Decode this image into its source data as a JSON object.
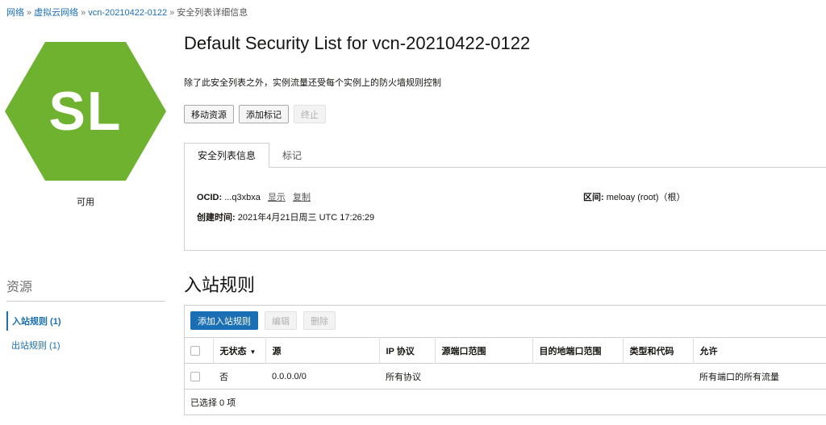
{
  "breadcrumb": {
    "items": [
      "网络",
      "虚拟云网络",
      "vcn-20210422-0122"
    ],
    "separator": "»",
    "current": "安全列表详细信息"
  },
  "avatar": {
    "initials": "SL",
    "color": "#6fb230",
    "status": "可用"
  },
  "page": {
    "title": "Default Security List for vcn-20210422-0122",
    "subtitle": "除了此安全列表之外，实例流量还受每个实例上的防火墙规则控制"
  },
  "actions": {
    "move": "移动资源",
    "add_tags": "添加标记",
    "terminate": "终止"
  },
  "tabs": [
    {
      "label": "安全列表信息",
      "active": true
    },
    {
      "label": "标记",
      "active": false
    }
  ],
  "info": {
    "ocid_label": "OCID:",
    "ocid_value": "...q3xbxa",
    "show_link": "显示",
    "copy_link": "复制",
    "created_label": "创建时间:",
    "created_value": "2021年4月21日周三 UTC 17:26:29",
    "compartment_label": "区间:",
    "compartment_value": "meloay (root)（根）"
  },
  "resources": {
    "title": "资源",
    "items": [
      {
        "label": "入站规则 (1)",
        "active": true
      },
      {
        "label": "出站规则 (1)",
        "active": false
      }
    ]
  },
  "ingress": {
    "title": "入站规则",
    "add_button": "添加入站规则",
    "edit_button": "编辑",
    "delete_button": "删除",
    "columns": [
      "无状态",
      "源",
      "IP 协议",
      "源端口范围",
      "目的地端口范围",
      "类型和代码",
      "允许"
    ],
    "rows": [
      {
        "stateless": "否",
        "source": "0.0.0.0/0",
        "protocol": "所有协议",
        "src_port": "",
        "dst_port": "",
        "type_code": "",
        "allows": "所有端口的所有流量"
      }
    ],
    "selected": "已选择 0 项"
  }
}
